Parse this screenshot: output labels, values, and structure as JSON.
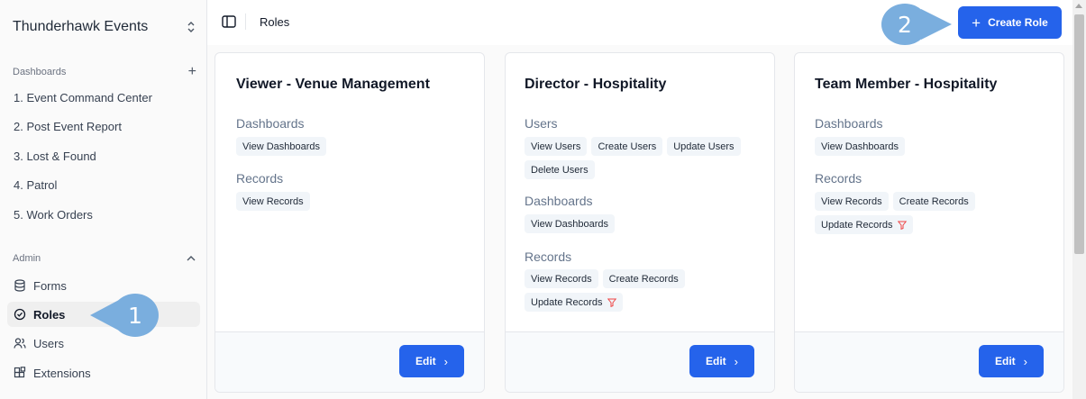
{
  "org": {
    "name": "Thunderhawk Events"
  },
  "sidebar": {
    "dashboards_label": "Dashboards",
    "dashboards": [
      {
        "label": "1. Event Command Center"
      },
      {
        "label": "2. Post Event Report"
      },
      {
        "label": "3. Lost & Found"
      },
      {
        "label": "4. Patrol"
      },
      {
        "label": "5. Work Orders"
      }
    ],
    "admin_label": "Admin",
    "admin": [
      {
        "label": "Forms",
        "icon": "database-icon"
      },
      {
        "label": "Roles",
        "icon": "check-circle-icon",
        "active": true
      },
      {
        "label": "Users",
        "icon": "users-icon"
      },
      {
        "label": "Extensions",
        "icon": "blocks-icon"
      }
    ]
  },
  "header": {
    "breadcrumb": "Roles",
    "create_button": "Create Role"
  },
  "callouts": {
    "one": "1",
    "two": "2"
  },
  "roles": [
    {
      "title": "Viewer - Venue Management",
      "groups": [
        {
          "label": "Dashboards",
          "permissions": [
            "View Dashboards"
          ]
        },
        {
          "label": "Records",
          "permissions": [
            "View Records"
          ]
        }
      ],
      "edit_label": "Edit"
    },
    {
      "title": "Director - Hospitality",
      "groups": [
        {
          "label": "Users",
          "permissions": [
            "View Users",
            "Create Users",
            "Update Users",
            "Delete Users"
          ]
        },
        {
          "label": "Dashboards",
          "permissions": [
            "View Dashboards"
          ]
        },
        {
          "label": "Records",
          "permissions": [
            "View Records",
            "Create Records",
            "Update Records"
          ]
        }
      ],
      "edit_label": "Edit"
    },
    {
      "title": "Team Member - Hospitality",
      "groups": [
        {
          "label": "Dashboards",
          "permissions": [
            "View Dashboards"
          ]
        },
        {
          "label": "Records",
          "permissions": [
            "View Records",
            "Create Records",
            "Update Records"
          ]
        }
      ],
      "edit_label": "Edit"
    }
  ],
  "colors": {
    "primary": "#2563eb",
    "callout": "#7aaede",
    "filter_icon": "#ef4444"
  }
}
